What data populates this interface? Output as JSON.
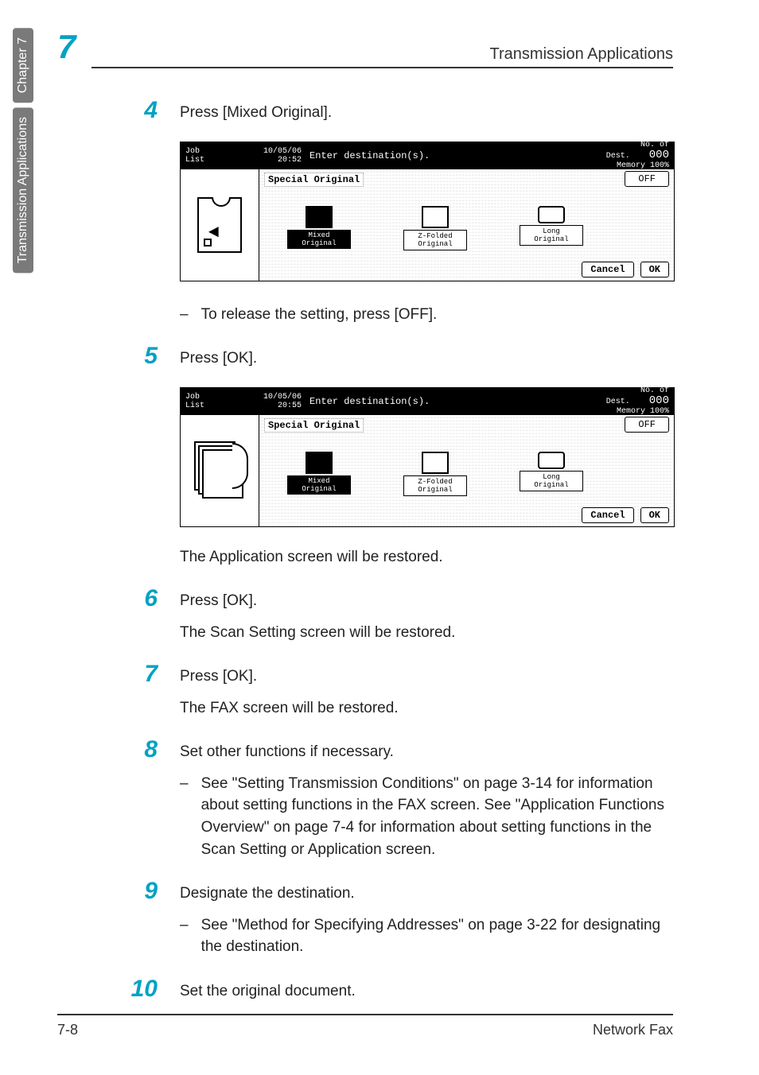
{
  "sideNumber": "7",
  "header": {
    "title": "Transmission Applications"
  },
  "tabs": {
    "chapter": "Chapter 7",
    "section": "Transmission Applications"
  },
  "steps": {
    "s4": {
      "num": "4",
      "text": "Press [Mixed Original].",
      "note": "To release the setting, press [OFF]."
    },
    "s5": {
      "num": "5",
      "text": "Press [OK].",
      "after": "The Application screen will be restored."
    },
    "s6": {
      "num": "6",
      "text": "Press [OK].",
      "after": "The Scan Setting screen will be restored."
    },
    "s7": {
      "num": "7",
      "text": "Press [OK].",
      "after": "The FAX screen will be restored."
    },
    "s8": {
      "num": "8",
      "text": "Set other functions if necessary.",
      "note": "See \"Setting Transmission Conditions\" on page 3-14 for information about setting functions in the FAX screen. See \"Application Functions Overview\" on page 7-4 for information about setting functions in the Scan Setting or Application screen."
    },
    "s9": {
      "num": "9",
      "text": "Designate the destination.",
      "note": "See \"Method for Specifying Addresses\" on page 3-22 for designating the destination."
    },
    "s10": {
      "num": "10",
      "text": "Set the original document."
    }
  },
  "lcd": {
    "jobTab": "Job\nList",
    "date1": "10/05/06",
    "time1": "20:52",
    "date2": "10/05/06",
    "time2": "20:55",
    "prompt": "Enter destination(s).",
    "destLabel": "No. of\nDest.",
    "destCount": "000",
    "memory": "Memory 100%",
    "panelTitle": "Special Original",
    "off": "OFF",
    "icons": {
      "mixed": "Mixed\nOriginal",
      "zfold": "Z-Folded\nOriginal",
      "long": "Long\nOriginal"
    },
    "cancel": "Cancel",
    "ok": "OK"
  },
  "footer": {
    "page": "7-8",
    "doc": "Network Fax"
  }
}
